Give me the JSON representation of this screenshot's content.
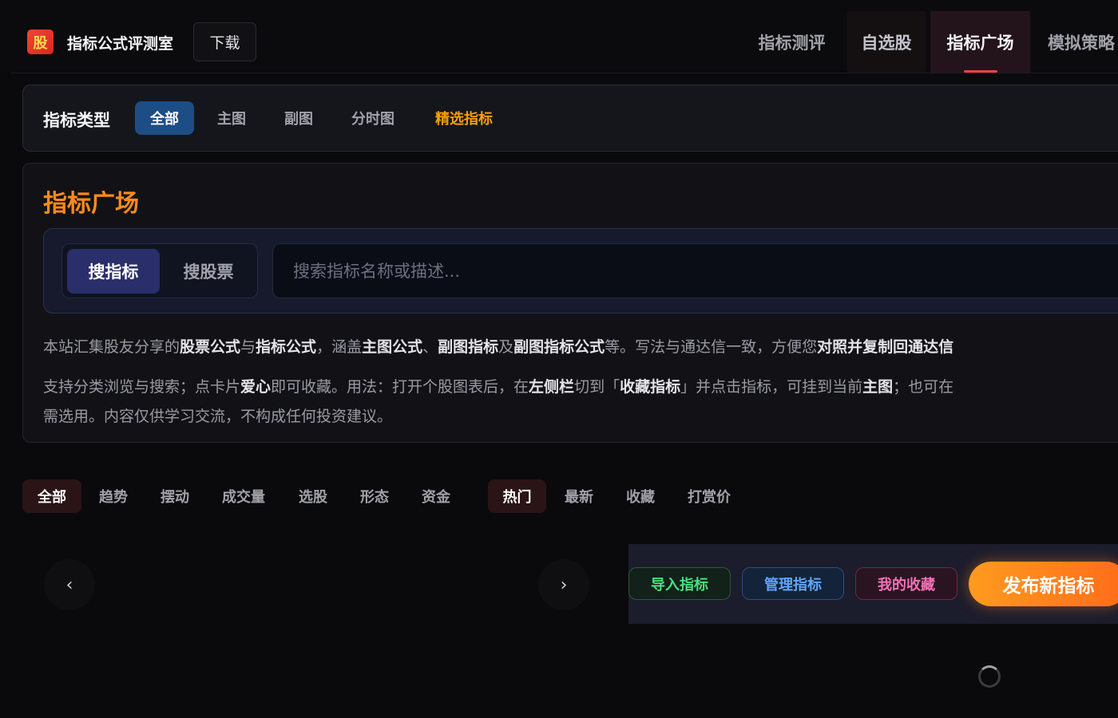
{
  "header": {
    "logo_glyph": "股",
    "brand": "指标公式评测室",
    "download": "下载",
    "nav": [
      "指标测评",
      "自选股",
      "指标广场",
      "模拟策略"
    ],
    "active_nav": "指标广场"
  },
  "type_filter": {
    "label": "指标类型",
    "options": [
      "全部",
      "主图",
      "副图",
      "分时图",
      "精选指标"
    ],
    "selected": "全部"
  },
  "plaza": {
    "title": "指标广场",
    "search_modes": [
      "搜指标",
      "搜股票"
    ],
    "search_mode_selected": "搜指标",
    "search_placeholder": "搜索指标名称或描述...",
    "desc1": {
      "t1": "本站汇集股友分享的",
      "b1": "股票公式",
      "t2": "与",
      "b2": "指标公式",
      "t3": "，涵盖",
      "b3": "主图公式",
      "t4": "、",
      "b4": "副图指标",
      "t5": "及",
      "b5": "副图指标公式",
      "t6": "等。写法与通达信一致，方便您",
      "b6": "对照并复制回通达信"
    },
    "desc2": {
      "t1": "支持分类浏览与搜索；点卡片",
      "b1": "爱心",
      "t2": "即可收藏。用法：打开个股图表后，在",
      "b2": "左侧栏",
      "t3": "切到「",
      "b3": "收藏指标",
      "t4": "」并点击指标，可挂到当前",
      "b4": "主图",
      "t5": "；也可在"
    },
    "desc3": "需选用。内容仅供学习交流，不构成任何投资建议。"
  },
  "category_filters": [
    "全部",
    "趋势",
    "摆动",
    "成交量",
    "选股",
    "形态",
    "资金"
  ],
  "category_selected": "全部",
  "sort_filters": [
    "热门",
    "最新",
    "收藏",
    "打赏价"
  ],
  "sort_selected": "热门",
  "carousel": {
    "prev": "‹",
    "next": "›"
  },
  "actions": {
    "import": "导入指标",
    "manage": "管理指标",
    "favorites": "我的收藏",
    "publish": "发布新指标"
  },
  "colors": {
    "accent_orange": "#ff8c1a",
    "active_blue": "#1d4d85",
    "nav_underline": "#ef4444"
  }
}
